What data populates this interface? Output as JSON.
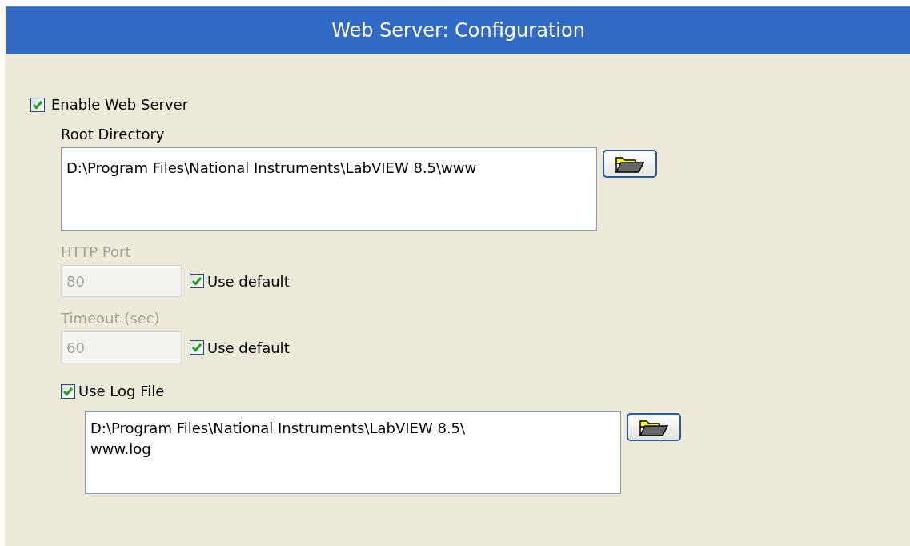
{
  "header": {
    "title": "Web Server: Configuration"
  },
  "enable": {
    "label": "Enable Web Server",
    "checked": true
  },
  "root_directory": {
    "label": "Root Directory",
    "value": "D:\\Program Files\\National Instruments\\LabVIEW 8.5\\www"
  },
  "ports": [
    {
      "label": "HTTP Port",
      "value": "80",
      "disabled": true,
      "default": {
        "label": "Use default",
        "checked": true
      }
    },
    {
      "label": "Timeout (sec)",
      "value": "60",
      "disabled": true,
      "default": {
        "label": "Use default",
        "checked": true
      }
    }
  ],
  "log": {
    "label": "Use Log File",
    "checked": true,
    "value": "D:\\Program Files\\National Instruments\\LabVIEW 8.5\\\nwww.log"
  }
}
